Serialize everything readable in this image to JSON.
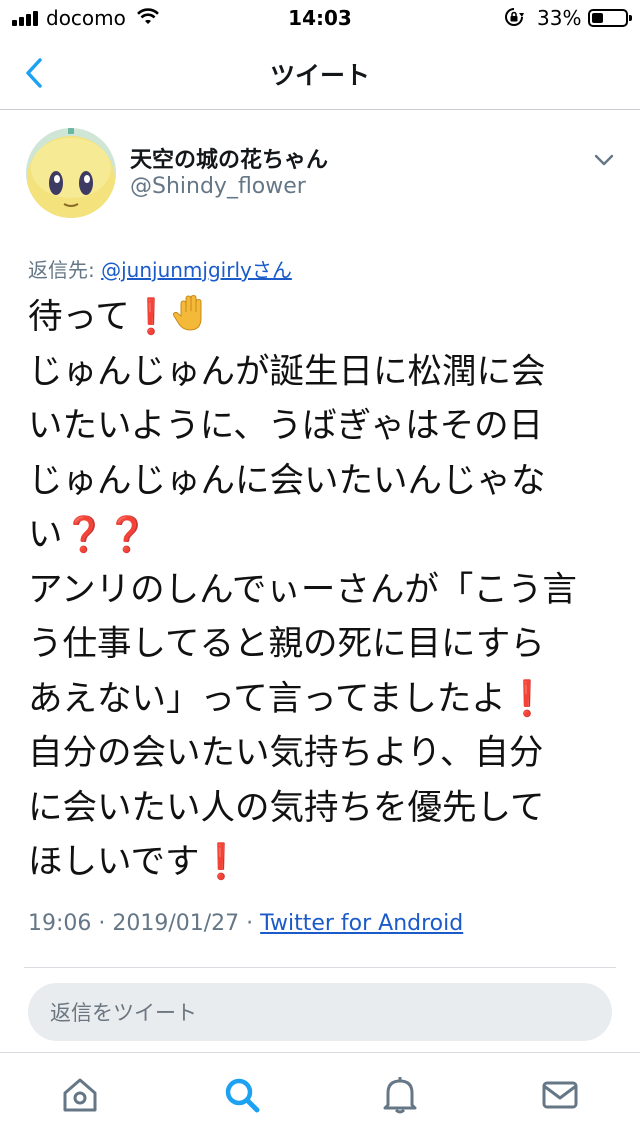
{
  "status_bar": {
    "carrier": "docomo",
    "time": "14:03",
    "battery_percent": "33%",
    "battery_level": 0.33
  },
  "nav": {
    "title": "ツイート",
    "back_icon": "chevron-left-icon"
  },
  "tweet": {
    "display_name": "天空の城の花ちゃん",
    "handle": "@Shindy_flower",
    "reply_prefix": "返信先: ",
    "reply_to": "@junjunmjgirlyさん",
    "lines": [
      "待って",
      "じゅんじゅんが誕生日に松潤に会",
      "いたいように、うばぎゃはその日",
      "じゅんじゅんに会いたいんじゃな",
      "い",
      "アンリのしんでぃーさんが「こう言",
      "う仕事してると親の死に目にすら",
      "あえない」って言ってましたよ",
      "自分の会いたい気持ちより、自分",
      "に会いたい人の気持ちを優先して",
      "ほしいです"
    ],
    "exclamation": "❗",
    "question": "❓",
    "timestamp": "19:06 · 2019/01/27 · ",
    "source": "Twitter for Android"
  },
  "reply_box": {
    "placeholder": "返信をツイート"
  },
  "tab_bar": {
    "icons": [
      "home-icon",
      "search-icon",
      "notifications-icon",
      "messages-icon"
    ],
    "active": "search-icon"
  },
  "colors": {
    "link": "#1b5bc9",
    "accent": "#1da1f2",
    "secondary_text": "#657786",
    "emoji_red": "#e0162b"
  }
}
